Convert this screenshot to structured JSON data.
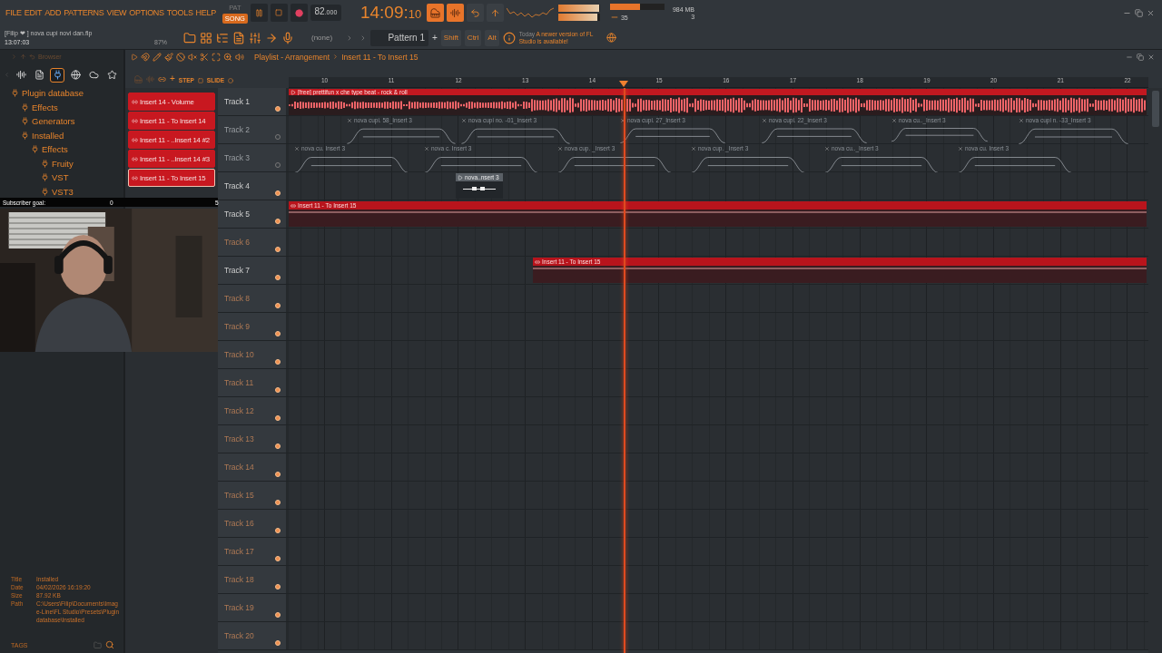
{
  "menu": [
    "FILE",
    "EDIT",
    "ADD",
    "PATTERNS",
    "VIEW",
    "OPTIONS",
    "TOOLS",
    "HELP"
  ],
  "modes": [
    {
      "label": "PAT",
      "selected": false
    },
    {
      "label": "SONG",
      "selected": true
    }
  ],
  "tempo": {
    "whole": "82",
    "fraction": ".000"
  },
  "clock": {
    "main": "14:09:",
    "seconds": "10"
  },
  "project": {
    "hint": "[Filip ❤    ] nova cupi novi dan.flp",
    "elapsed": "13:07:03",
    "zoom": "87%"
  },
  "master_meters": [
    {
      "level": 0.97
    },
    {
      "level": 0.93
    }
  ],
  "cpu": {
    "level": 0.55,
    "polyphony": "35"
  },
  "memory": {
    "used": "984 MB",
    "count": "3"
  },
  "pattern_selector": {
    "value": "(none)"
  },
  "pattern": {
    "name": "Pattern 1",
    "add": "+"
  },
  "modifiers": [
    "Shift",
    "Ctrl",
    "Alt"
  ],
  "hint_panel": {
    "time": "Today",
    "message": "A newer version of FL Studio is available!"
  },
  "browser": {
    "title": "Browser",
    "tree": [
      {
        "label": "Plugin database",
        "children": [
          {
            "label": "Effects"
          },
          {
            "label": "Generators"
          },
          {
            "label": "Installed",
            "children": [
              {
                "label": "Effects",
                "children": [
                  {
                    "label": "Fruity"
                  },
                  {
                    "label": "VST"
                  },
                  {
                    "label": "VST3"
                  }
                ]
              }
            ]
          }
        ]
      }
    ],
    "info": [
      {
        "key": "Title",
        "value": "Installed"
      },
      {
        "key": "Date",
        "value": "04/02/2026 16:19:20"
      },
      {
        "key": "Size",
        "value": "87.92 KB"
      },
      {
        "key": "Path",
        "value": "C:\\Users\\Filip\\Documents\\Image-Line\\FL Studio\\Presets\\Plugin database\\Installed"
      }
    ],
    "tags": "TAGS"
  },
  "subscriber_goal": {
    "label": "Subscriber goal:",
    "current": "0",
    "target": "5",
    "level": 0
  },
  "webcam": {
    "kind": "picture"
  },
  "playlist": {
    "title": "Playlist - Arrangement",
    "breadcrumb": "Insert 11 - To Insert 15",
    "add": "+",
    "step": "STEP",
    "slide": "SLIDE",
    "clip_sources": [
      {
        "label": "Insert 14 - Volume",
        "selected": false
      },
      {
        "label": "Insert 11 - To Insert 14",
        "selected": false
      },
      {
        "label": "Insert 11 - ..Insert 14 #2",
        "selected": false
      },
      {
        "label": "Insert 11 - ..Insert 14 #3",
        "selected": false
      },
      {
        "label": "Insert 11 - To Insert 15",
        "selected": true
      }
    ],
    "ruler": [
      "10",
      "11",
      "12",
      "13",
      "14",
      "15",
      "16",
      "17",
      "18",
      "19",
      "20",
      "21",
      "22"
    ],
    "tracks": [
      {
        "name": "Track 1",
        "muted": false,
        "clips": [
          {
            "kind": "audio",
            "label": "[free] prettifun x che type beat - rock & roll"
          }
        ]
      },
      {
        "name": "Track 2",
        "muted": true,
        "clips": [
          {
            "kind": "sample",
            "label": "nova cupi. 58_Insert 3"
          },
          {
            "kind": "sample",
            "label": "nova cupi no. -01_Insert 3"
          },
          {
            "kind": "sample",
            "label": "nova cupi. 27_Insert 3"
          },
          {
            "kind": "sample",
            "label": "nova cupi. 22_Insert 3"
          },
          {
            "kind": "sample",
            "label": "nova cu.._Insert 3"
          },
          {
            "kind": "sample",
            "label": "nova cupi n. -33_Insert 3"
          }
        ]
      },
      {
        "name": "Track 3",
        "muted": true,
        "clips": [
          {
            "kind": "sample",
            "label": "nova cu. Insert 3"
          },
          {
            "kind": "sample",
            "label": "nova c. Insert 3"
          },
          {
            "kind": "sample",
            "label": "nova cup. _Insert 3"
          },
          {
            "kind": "sample",
            "label": "nova cup. _Insert 3"
          },
          {
            "kind": "sample",
            "label": "nova cu.._Insert 3"
          },
          {
            "kind": "sample",
            "label": "nova cu. Insert 3"
          }
        ]
      },
      {
        "name": "Track 4",
        "muted": false,
        "clips": [
          {
            "kind": "pattern",
            "label": "nova..nsert 3"
          }
        ]
      },
      {
        "name": "Track 5",
        "muted": false,
        "clips": [
          {
            "kind": "automation",
            "label": "Insert 11 - To Insert 15"
          }
        ]
      },
      {
        "name": "Track 6",
        "muted": false
      },
      {
        "name": "Track 7",
        "muted": false,
        "clips": [
          {
            "kind": "automation",
            "label": "Insert 11 - To Insert 15"
          }
        ]
      },
      {
        "name": "Track 8",
        "muted": false
      },
      {
        "name": "Track 9",
        "muted": false
      },
      {
        "name": "Track 10",
        "muted": false
      },
      {
        "name": "Track 11",
        "muted": false
      },
      {
        "name": "Track 12",
        "muted": false
      },
      {
        "name": "Track 13",
        "muted": false
      },
      {
        "name": "Track 14",
        "muted": false
      },
      {
        "name": "Track 15",
        "muted": false
      },
      {
        "name": "Track 16",
        "muted": false
      },
      {
        "name": "Track 17",
        "muted": false
      },
      {
        "name": "Track 18",
        "muted": false
      },
      {
        "name": "Track 19",
        "muted": false
      },
      {
        "name": "Track 20",
        "muted": false
      }
    ]
  }
}
